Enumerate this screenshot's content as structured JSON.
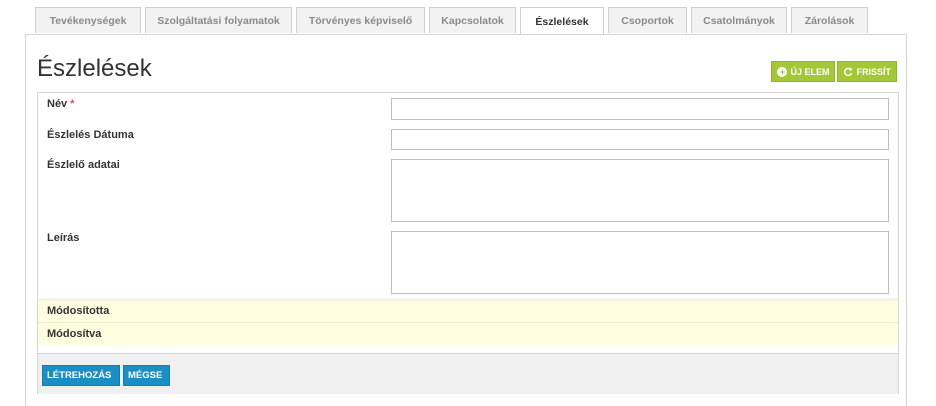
{
  "tabs": [
    {
      "label": "Tevékenységek",
      "active": false
    },
    {
      "label": "Szolgáltatási folyamatok",
      "active": false
    },
    {
      "label": "Törvényes képviselő",
      "active": false
    },
    {
      "label": "Kapcsolatok",
      "active": false
    },
    {
      "label": "Észlelések",
      "active": true
    },
    {
      "label": "Csoportok",
      "active": false
    },
    {
      "label": "Csatolmányok",
      "active": false
    },
    {
      "label": "Zárolások",
      "active": false
    }
  ],
  "page": {
    "title": "Észlelések"
  },
  "toolbar": {
    "new_label": "ÚJ ELEM",
    "refresh_label": "FRISSÍT",
    "new_icon": "plus-circle-icon",
    "refresh_icon": "refresh-icon"
  },
  "form": {
    "name_label": "Név",
    "required_mark": "*",
    "date_label": "Észlelés Dátuma",
    "observer_label": "Észlelő adatai",
    "description_label": "Leírás",
    "name_value": "",
    "date_value": "",
    "observer_value": "",
    "description_value": "",
    "modified_by_label": "Módosította",
    "modified_at_label": "Módosítva"
  },
  "footer": {
    "create_label": "LÉTREHOZÁS",
    "cancel_label": "MÉGSE"
  },
  "colors": {
    "accent_green": "#a4c639",
    "accent_blue": "#1b8fc4",
    "meta_bg": "#fdfde0"
  }
}
